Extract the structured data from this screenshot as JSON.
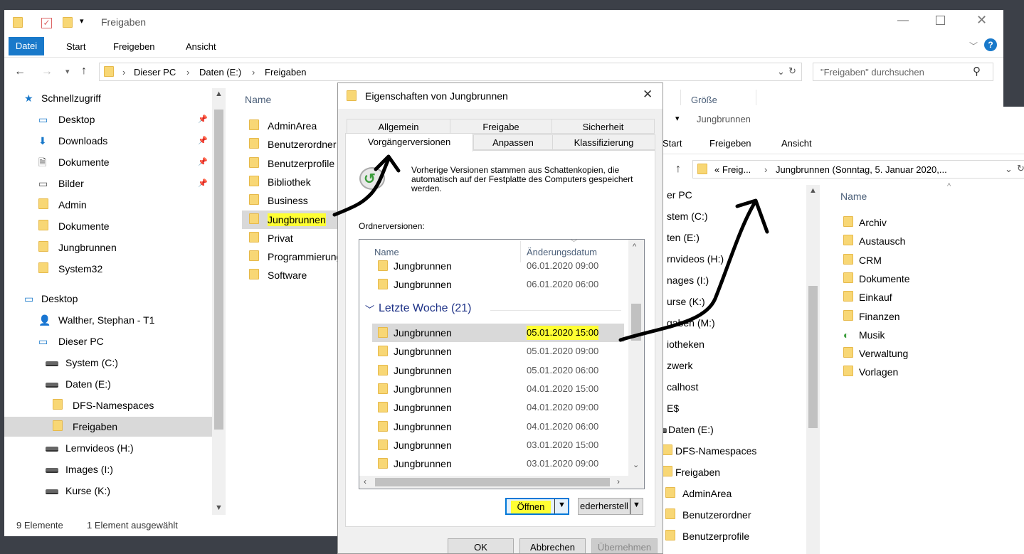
{
  "main_window": {
    "title": "Freigaben",
    "ribbon": [
      "Datei",
      "Start",
      "Freigeben",
      "Ansicht"
    ],
    "address": [
      "Dieser PC",
      "Daten (E:)",
      "Freigaben"
    ],
    "search_placeholder": "\"Freigaben\" durchsuchen",
    "nav": [
      {
        "label": "Schnellzugriff",
        "icon": "star-icon",
        "level": 0,
        "pinned": false
      },
      {
        "label": "Desktop",
        "icon": "desktop-icon",
        "level": 1,
        "pinned": true
      },
      {
        "label": "Downloads",
        "icon": "download-icon",
        "level": 1,
        "pinned": true
      },
      {
        "label": "Dokumente",
        "icon": "document-icon",
        "level": 1,
        "pinned": true
      },
      {
        "label": "Bilder",
        "icon": "pictures-icon",
        "level": 1,
        "pinned": true
      },
      {
        "label": "Admin",
        "icon": "folder-icon",
        "level": 1,
        "pinned": false
      },
      {
        "label": "Dokumente",
        "icon": "folder-icon",
        "level": 1,
        "pinned": false
      },
      {
        "label": "Jungbrunnen",
        "icon": "folder-icon",
        "level": 1,
        "pinned": false
      },
      {
        "label": "System32",
        "icon": "folder-icon",
        "level": 1,
        "pinned": false
      },
      {
        "label": "Desktop",
        "icon": "desktop-icon",
        "level": 0,
        "pinned": false
      },
      {
        "label": "Walther, Stephan - T1",
        "icon": "user-icon",
        "level": 1,
        "pinned": false
      },
      {
        "label": "Dieser PC",
        "icon": "computer-icon",
        "level": 1,
        "pinned": false
      },
      {
        "label": "System (C:)",
        "icon": "drive-icon",
        "level": 2,
        "pinned": false
      },
      {
        "label": "Daten (E:)",
        "icon": "drive-icon",
        "level": 2,
        "pinned": false
      },
      {
        "label": "DFS-Namespaces",
        "icon": "folder-icon",
        "level": 3,
        "pinned": false
      },
      {
        "label": "Freigaben",
        "icon": "folder-icon",
        "level": 3,
        "pinned": false,
        "selected": true
      },
      {
        "label": "Lernvideos (H:)",
        "icon": "drive-icon",
        "level": 2,
        "pinned": false
      },
      {
        "label": "Images (I:)",
        "icon": "drive-icon",
        "level": 2,
        "pinned": false
      },
      {
        "label": "Kurse (K:)",
        "icon": "drive-icon",
        "level": 2,
        "pinned": false
      }
    ],
    "col_name": "Name",
    "col_size": "Größe",
    "files": [
      "AdminArea",
      "Benutzerordner",
      "Benutzerprofile",
      "Bibliothek",
      "Business",
      "Jungbrunnen",
      "Privat",
      "Programmierung",
      "Software"
    ],
    "status_count": "9 Elemente",
    "status_selected": "1 Element ausgewählt"
  },
  "dialog": {
    "title": "Eigenschaften von Jungbrunnen",
    "tabs_row1": [
      "Allgemein",
      "Freigabe",
      "Sicherheit"
    ],
    "tabs_row2": [
      "Vorgängerversionen",
      "Anpassen",
      "Klassifizierung"
    ],
    "info": "Vorherige Versionen stammen aus Schattenkopien, die automatisch auf der Festplatte des Computers gespeichert werden.",
    "versions_label": "Ordnerversionen:",
    "col_name": "Name",
    "col_date": "Änderungsdatum",
    "group": "Letzte Woche (21)",
    "versions_top": [
      {
        "name": "Jungbrunnen",
        "date": "06.01.2020 09:00"
      },
      {
        "name": "Jungbrunnen",
        "date": "06.01.2020 06:00"
      }
    ],
    "versions": [
      {
        "name": "Jungbrunnen",
        "date": "05.01.2020 15:00"
      },
      {
        "name": "Jungbrunnen",
        "date": "05.01.2020 09:00"
      },
      {
        "name": "Jungbrunnen",
        "date": "05.01.2020 06:00"
      },
      {
        "name": "Jungbrunnen",
        "date": "04.01.2020 15:00"
      },
      {
        "name": "Jungbrunnen",
        "date": "04.01.2020 09:00"
      },
      {
        "name": "Jungbrunnen",
        "date": "04.01.2020 06:00"
      },
      {
        "name": "Jungbrunnen",
        "date": "03.01.2020 15:00"
      },
      {
        "name": "Jungbrunnen",
        "date": "03.01.2020 09:00"
      }
    ],
    "btn_open": "Öffnen",
    "btn_restore": "ederherstell",
    "btn_ok": "OK",
    "btn_cancel": "Abbrechen",
    "btn_apply": "Übernehmen"
  },
  "second_window": {
    "title": "Jungbrunnen",
    "ribbon": [
      "Start",
      "Freigeben",
      "Ansicht"
    ],
    "address": [
      "« Freig...",
      "Jungbrunnen (Sonntag, 5. Januar 2020,..."
    ],
    "nav": [
      "er PC",
      "stem (C:)",
      "ten (E:)",
      "rnvideos (H:)",
      "nages (I:)",
      "urse (K:)",
      "gaben (M:)",
      "iotheken",
      "zwerk",
      "calhost",
      "E$",
      "Daten (E:)",
      "DFS-Namespaces",
      "Freigaben",
      "AdminArea",
      "Benutzerordner",
      "Benutzerprofile"
    ],
    "col_name": "Name",
    "files": [
      {
        "name": "Archiv",
        "icon": "folder-icon"
      },
      {
        "name": "Austausch",
        "icon": "folder-icon"
      },
      {
        "name": "CRM",
        "icon": "folder-icon"
      },
      {
        "name": "Dokumente",
        "icon": "folder-icon"
      },
      {
        "name": "Einkauf",
        "icon": "folder-icon"
      },
      {
        "name": "Finanzen",
        "icon": "folder-icon"
      },
      {
        "name": "Musik",
        "icon": "music-icon"
      },
      {
        "name": "Verwaltung",
        "icon": "folder-icon"
      },
      {
        "name": "Vorlagen",
        "icon": "folder-icon"
      }
    ]
  }
}
